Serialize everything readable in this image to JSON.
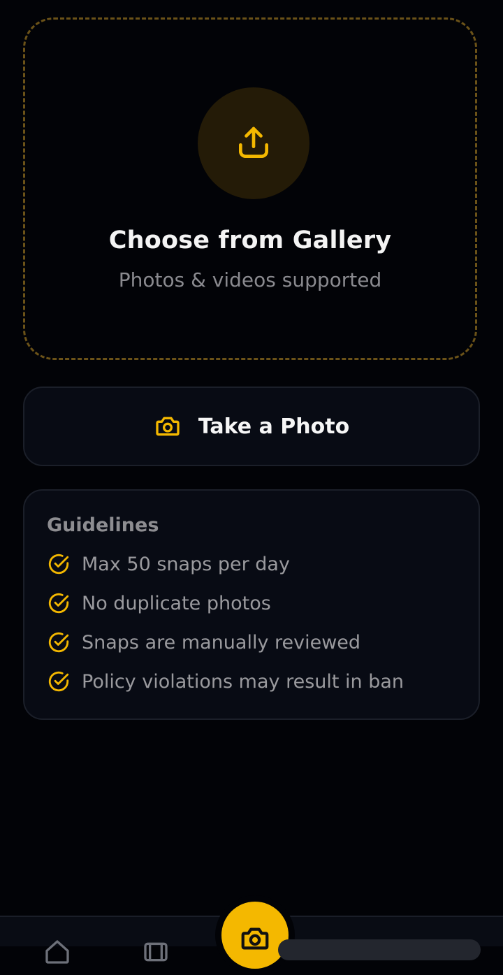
{
  "colors": {
    "accent": "#f4b800",
    "background": "#020307",
    "card": "#080b14",
    "border": "#1b1f29",
    "dashed_border": "#6b5218"
  },
  "gallery": {
    "icon": "upload-icon",
    "title": "Choose from Gallery",
    "subtitle": "Photos & videos supported"
  },
  "take_photo": {
    "icon": "camera-icon",
    "label": "Take a Photo"
  },
  "guidelines": {
    "title": "Guidelines",
    "icon": "check-circle-icon",
    "items": [
      "Max 50 snaps per day",
      "No duplicate photos",
      "Snaps are manually reviewed",
      "Policy violations may result in ban"
    ]
  },
  "bottom_nav": {
    "items": [
      "home-icon",
      "film-icon",
      "camera-icon"
    ]
  }
}
